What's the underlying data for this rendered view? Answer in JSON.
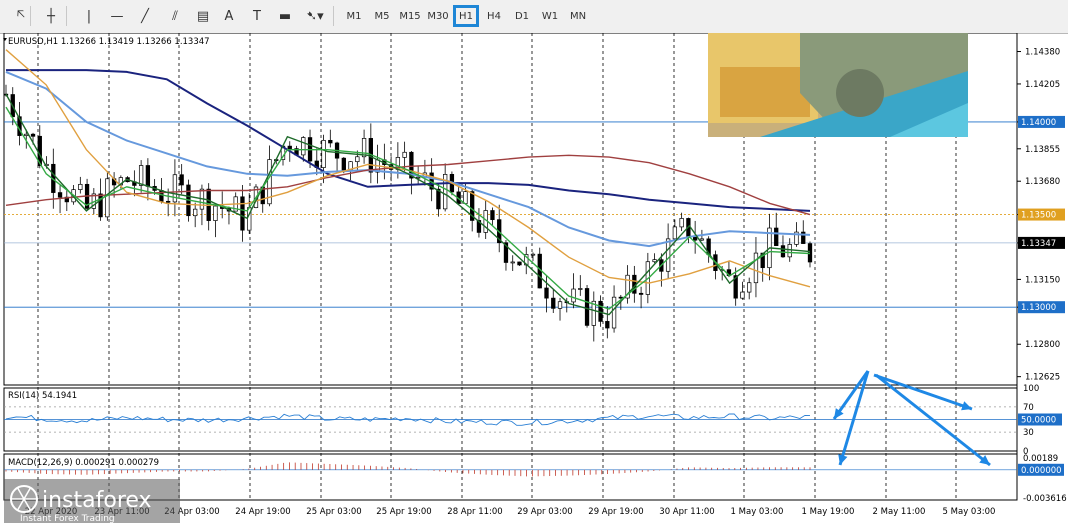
{
  "toolbar": {
    "tools": [
      {
        "name": "cursor-icon",
        "glyph": "🡤"
      },
      {
        "name": "crosshair-icon",
        "glyph": "┼"
      },
      {
        "name": "vertical-line-icon",
        "glyph": "|"
      },
      {
        "name": "horizontal-line-icon",
        "glyph": "—"
      },
      {
        "name": "trendline-icon",
        "glyph": "╱"
      },
      {
        "name": "channel-icon",
        "glyph": "⫽"
      },
      {
        "name": "fibonacci-icon",
        "glyph": "▤"
      },
      {
        "name": "text-icon",
        "glyph": "A"
      },
      {
        "name": "text-label-icon",
        "glyph": "T"
      },
      {
        "name": "rectangle-icon",
        "glyph": "▬"
      },
      {
        "name": "shapes-dropdown-icon",
        "glyph": "➷▾"
      }
    ],
    "timeframes": [
      "M1",
      "M5",
      "M15",
      "M30",
      "H1",
      "H4",
      "D1",
      "W1",
      "MN"
    ],
    "selected_timeframe": "H1"
  },
  "chart_data": [
    {
      "type": "line",
      "title": "EURUSD,H1  1.13266 1.13419 1.13266 1.13347",
      "x_ticks": [
        "22 Apr 2020",
        "23 Apr 11:00",
        "24 Apr 03:00",
        "24 Apr 19:00",
        "25 Apr 03:00",
        "25 Apr 19:00",
        "28 Apr 11:00",
        "29 Apr 03:00",
        "29 Apr 19:00",
        "30 Apr 11:00",
        "1 May 03:00",
        "1 May 19:00",
        "2 May 11:00",
        "5 May 03:00"
      ],
      "y_ticks": [
        "1.14380",
        "1.14205",
        "1.14000",
        "1.13855",
        "1.13680",
        "1.13500",
        "1.13347",
        "1.13150",
        "1.13000",
        "1.12800",
        "1.12625"
      ],
      "ylim": [
        1.1258,
        1.1448
      ],
      "horizontal_levels": [
        {
          "value": 1.14,
          "label": "1.14000",
          "color": "#1e6fc8"
        },
        {
          "value": 1.135,
          "label": "1.13500",
          "color": "#e0a020"
        },
        {
          "value": 1.13347,
          "label": "1.13347",
          "color": "#000000"
        },
        {
          "value": 1.13,
          "label": "1.13000",
          "color": "#1e6fc8"
        }
      ],
      "series": [
        {
          "name": "",
          "color": "#1a237e",
          "values": [
            1.1428,
            1.1428,
            1.1428,
            1.1427,
            1.1423,
            1.141,
            1.1398,
            1.1385,
            1.1372,
            1.1365,
            1.1366,
            1.1367,
            1.1367,
            1.1366,
            1.1363,
            1.1361,
            1.1358,
            1.1356,
            1.1354,
            1.1353,
            1.1352
          ]
        },
        {
          "name": "",
          "color": "#6699dd",
          "values": [
            1.1427,
            1.1418,
            1.14,
            1.139,
            1.1383,
            1.1376,
            1.1372,
            1.1371,
            1.1373,
            1.1374,
            1.1372,
            1.1368,
            1.1361,
            1.1354,
            1.1343,
            1.1336,
            1.1333,
            1.1338,
            1.1341,
            1.134,
            1.1339
          ]
        },
        {
          "name": "",
          "color": "#a04040",
          "values": [
            1.1355,
            1.1358,
            1.136,
            1.1361,
            1.1362,
            1.1363,
            1.1363,
            1.1365,
            1.137,
            1.1374,
            1.1376,
            1.1377,
            1.1379,
            1.1381,
            1.1382,
            1.1381,
            1.1378,
            1.1372,
            1.1365,
            1.1356,
            1.135
          ]
        },
        {
          "name": "",
          "color": "#e0a040",
          "values": [
            1.1439,
            1.142,
            1.1385,
            1.1362,
            1.1356,
            1.1355,
            1.1356,
            1.1362,
            1.1371,
            1.1377,
            1.1374,
            1.1368,
            1.1357,
            1.1343,
            1.1327,
            1.1316,
            1.1313,
            1.1318,
            1.1325,
            1.1317,
            1.1311
          ]
        },
        {
          "name": "",
          "color": "#1e6b2a",
          "values": [
            1.1415,
            1.1376,
            1.1352,
            1.1369,
            1.1362,
            1.1358,
            1.1348,
            1.1392,
            1.1384,
            1.1382,
            1.1372,
            1.136,
            1.1342,
            1.1322,
            1.1302,
            1.1296,
            1.132,
            1.1344,
            1.1313,
            1.1332,
            1.133
          ]
        },
        {
          "name": "",
          "color": "#33aa44",
          "values": [
            1.1408,
            1.1372,
            1.1355,
            1.1365,
            1.136,
            1.1356,
            1.1352,
            1.1385,
            1.1385,
            1.1383,
            1.1374,
            1.1363,
            1.1346,
            1.1326,
            1.1306,
            1.1299,
            1.1316,
            1.1338,
            1.1317,
            1.133,
            1.1329
          ]
        }
      ]
    },
    {
      "type": "line",
      "title": "RSI(14) 54.1941",
      "y_ticks": [
        "100",
        "70",
        "50.0000",
        "30",
        "0"
      ],
      "ylim": [
        0,
        100
      ],
      "series": [
        {
          "name": "",
          "color": "#2a7fd4",
          "values": [
            55,
            51,
            48,
            53,
            50,
            49,
            52,
            56,
            51,
            50,
            52,
            47,
            46,
            45,
            48,
            52,
            56,
            53,
            55,
            52,
            54
          ]
        }
      ]
    },
    {
      "type": "bar",
      "title": "MACD(12,26,9) 0.000291 0.000279",
      "y_ticks": [
        "0.00189",
        "0.000000",
        "-0.003616"
      ],
      "ylim": [
        -0.003616,
        0.00189
      ],
      "series": [
        {
          "name": "",
          "color": "#c0392b",
          "values": [
            -0.0002,
            -0.0005,
            -0.0006,
            -0.0004,
            -0.0002,
            -0.0002,
            0.0001,
            0.0009,
            0.0007,
            0.0005,
            0.0002,
            -0.0003,
            -0.0006,
            -0.0008,
            -0.0007,
            -0.0005,
            -0.0002,
            0.0003,
            0.0002,
            0.0003,
            0.0003
          ]
        }
      ]
    }
  ],
  "watermark": {
    "brand": "instaforex",
    "tagline": "Instant Forex Trading"
  }
}
